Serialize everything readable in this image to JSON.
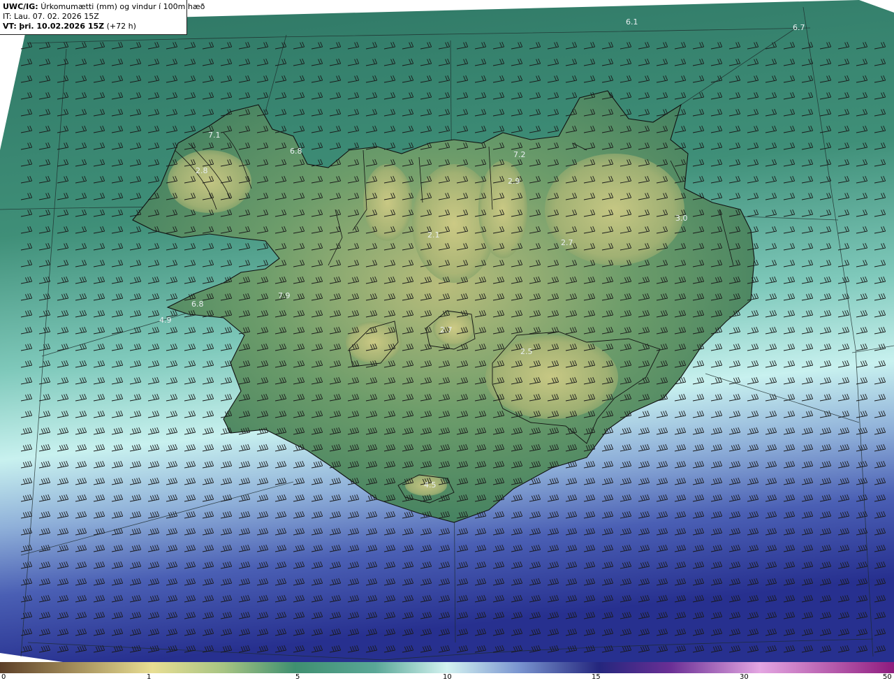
{
  "header": {
    "model": "UWC/IG:",
    "title": "Úrkomumætti (mm) og vindur í 100m hæð",
    "init_time": "IT: Lau. 07. 02. 2026 15Z",
    "valid_prefix": "VT:",
    "valid_time": "þri. 10.02.2026 15Z",
    "lead": "(+72 h)"
  },
  "value_labels": [
    {
      "text": "6.1"
    },
    {
      "text": "6.7"
    },
    {
      "text": "7.1"
    },
    {
      "text": "6.8"
    },
    {
      "text": "2.8"
    },
    {
      "text": "7.2"
    },
    {
      "text": "2.9"
    },
    {
      "text": "3.0"
    },
    {
      "text": "2.7"
    },
    {
      "text": "2.1"
    },
    {
      "text": "7.9"
    },
    {
      "text": "6.8"
    },
    {
      "text": "4.9"
    },
    {
      "text": "2.7"
    },
    {
      "text": "2.5"
    },
    {
      "text": "4.5"
    }
  ],
  "colorbar": {
    "labels": [
      "0",
      "1",
      "5",
      "10",
      "15",
      "30",
      "50"
    ],
    "stops": [
      "#5c3f28",
      "#c9b46f",
      "#f3ea9a",
      "#7ea868",
      "#2f7a5f",
      "#4e9f90",
      "#cff3f3",
      "#6f8fcf",
      "#2a2c8c",
      "#1a1470",
      "#9b3fa8",
      "#e6a4e4",
      "#8e1b7e"
    ]
  },
  "colors": {
    "sea_north": "#2f7d66",
    "sea_south": "#3a49a3",
    "land_high": "#c9c582",
    "land_mid": "#4f8b62",
    "coastline": "#111111",
    "barb": "#1a1a1a"
  }
}
